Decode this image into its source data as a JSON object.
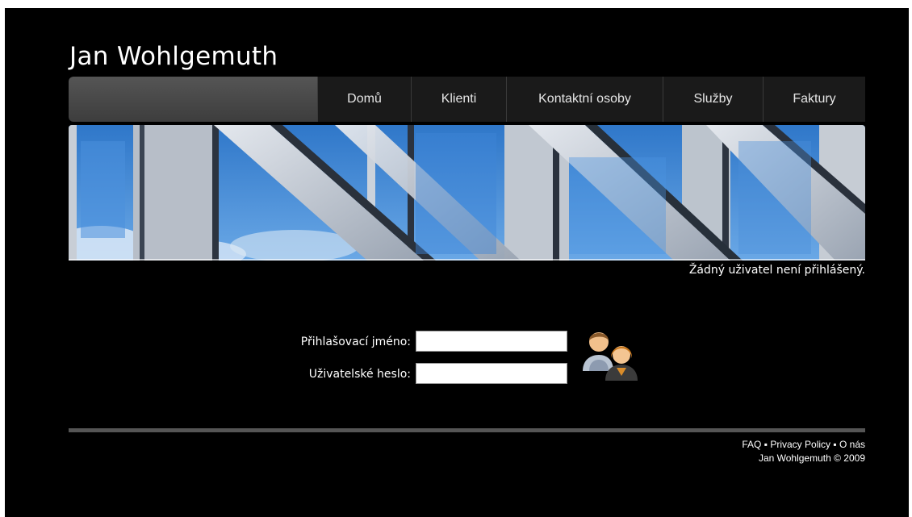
{
  "site": {
    "title": "Jan Wohlgemuth"
  },
  "nav": {
    "items": [
      {
        "label": "Domů"
      },
      {
        "label": "Klienti"
      },
      {
        "label": "Kontaktní osoby"
      },
      {
        "label": "Služby"
      },
      {
        "label": "Faktury"
      }
    ]
  },
  "status": {
    "text": "Žádný uživatel není přihlášený."
  },
  "login": {
    "username_label": "Přihlašovací jméno:",
    "username_value": "",
    "password_label": "Uživatelské heslo:",
    "password_value": "",
    "icon": "users-icon"
  },
  "footer": {
    "links": [
      "FAQ",
      "Privacy Policy",
      "O nás"
    ],
    "separator": "▪",
    "copyright": "Jan Wohlgemuth © 2009"
  },
  "colors": {
    "background": "#000000",
    "nav_item": "#1a1a1a",
    "nav_spacer": "#4a4a4a",
    "footer_rule": "#555555",
    "text": "#ffffff"
  }
}
